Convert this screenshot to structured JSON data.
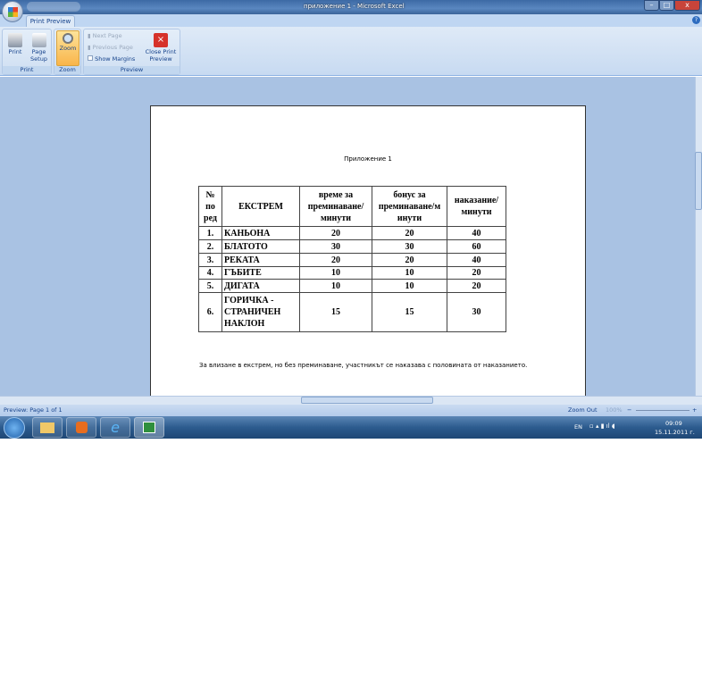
{
  "window": {
    "title": "приложение 1 - Microsoft Excel",
    "min": "–",
    "max": "□",
    "close": "x"
  },
  "ribbon": {
    "tab": "Print Preview",
    "print_group": {
      "label": "Print",
      "print": "Print",
      "page_setup_1": "Page",
      "page_setup_2": "Setup"
    },
    "zoom_group": {
      "label": "Zoom",
      "zoom": "Zoom"
    },
    "preview_group": {
      "label": "Preview",
      "next_page": "Next Page",
      "previous_page": "Previous Page",
      "show_margins": "Show Margins",
      "close_1": "Close Print",
      "close_2": "Preview"
    }
  },
  "document": {
    "caption": "Приложение 1",
    "headers": [
      "№ по ред",
      "ЕКСТРЕМ",
      "време за преминаване/ минути",
      "бонус за преминаване/м инути",
      "наказание/ минути"
    ],
    "rows": [
      [
        "1.",
        "КАНЬОНА",
        "20",
        "20",
        "40"
      ],
      [
        "2.",
        "БЛАТОТО",
        "30",
        "30",
        "60"
      ],
      [
        "3.",
        "РЕКАТА",
        "20",
        "20",
        "40"
      ],
      [
        "4.",
        "ГЪБИТЕ",
        "10",
        "10",
        "20"
      ],
      [
        "5.",
        "ДИГАТА",
        "10",
        "10",
        "20"
      ],
      [
        "6.",
        "ГОРИЧКА - СТРАНИЧЕН НАКЛОН",
        "15",
        "15",
        "30"
      ]
    ],
    "note": "За влизане в екстрем, но без преминаване, участникът се наказава с половината от наказанието."
  },
  "status": {
    "page": "Preview: Page 1 of 1",
    "zoom_out": "Zoom Out",
    "zoom_level": "100%",
    "minus": "−",
    "plus": "+"
  },
  "taskbar": {
    "lang": "EN",
    "time": "09:09",
    "date": "15.11.2011 г."
  }
}
